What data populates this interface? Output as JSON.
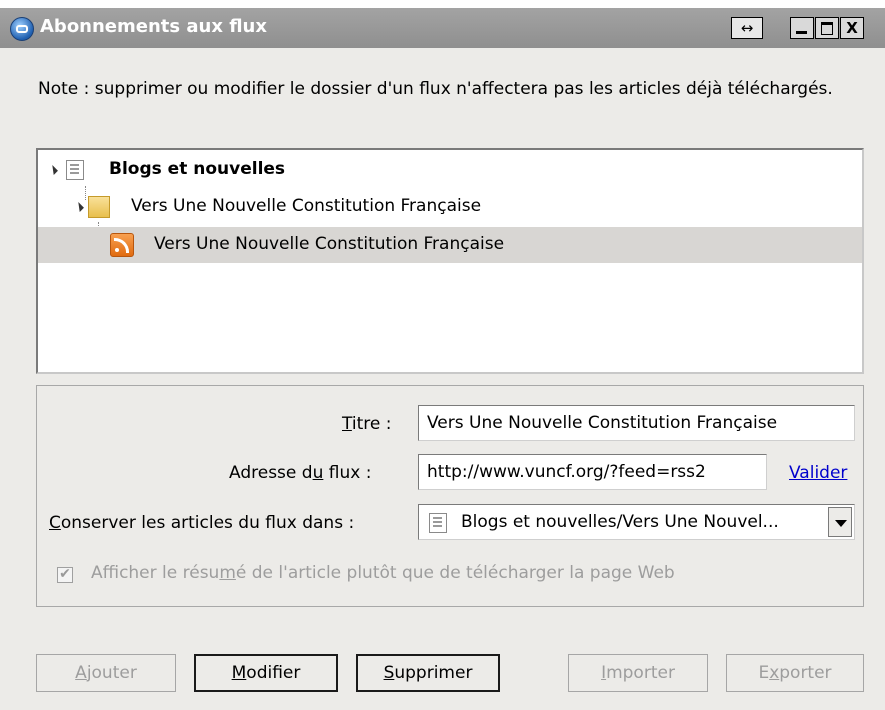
{
  "window": {
    "title": "Abonnements aux flux",
    "resize_glyph": "↔",
    "close_glyph": "X"
  },
  "note": "Note : supprimer ou modifier le dossier d'un flux n'affectera pas les articles déjà téléchargés.",
  "tree": {
    "items": [
      {
        "label": "Blogs et nouvelles",
        "icon": "newspaper-icon",
        "level": 0,
        "bold": true
      },
      {
        "label": "Vers Une Nouvelle Constitution Française",
        "icon": "folder-icon",
        "level": 1
      },
      {
        "label": "Vers Une Nouvelle Constitution Française",
        "icon": "rss-feed-icon",
        "level": 2,
        "selected": true
      }
    ]
  },
  "form": {
    "title_label": "Titre :",
    "title_value": "Vers Une Nouvelle Constitution Française",
    "url_label": "Adresse du flux :",
    "url_value": "http://www.vuncf.org/?feed=rss2",
    "validate_link": "Valider",
    "folder_label": "Conserver les articles du flux dans :",
    "folder_value": "Blogs et nouvelles/Vers Une Nouvel...",
    "summary_checkbox_label": "Afficher le résumé de l'article plutôt que de télécharger la page Web",
    "summary_checked": true
  },
  "buttons": {
    "add": "Ajouter",
    "modify": "Modifier",
    "delete": "Supprimer",
    "import": "Importer",
    "export": "Exporter"
  }
}
